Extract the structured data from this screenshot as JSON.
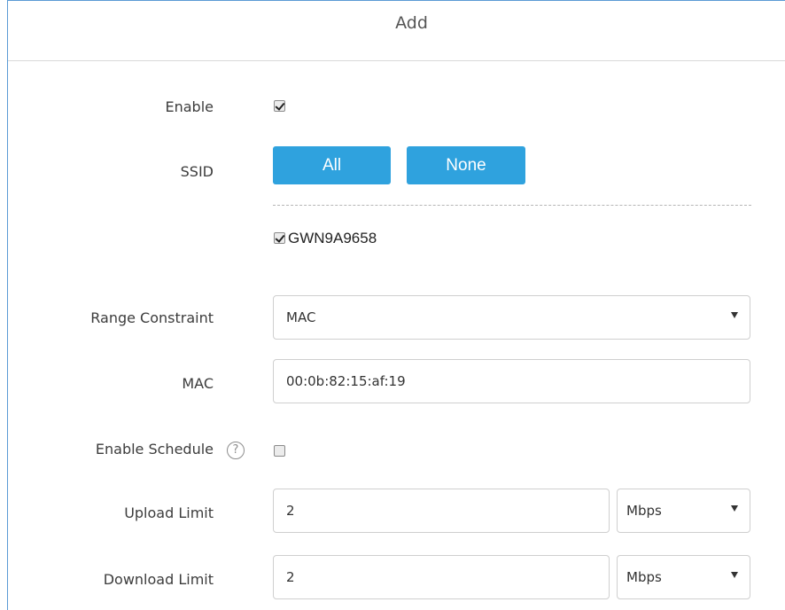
{
  "dialog": {
    "title": "Add"
  },
  "form": {
    "enable": {
      "label": "Enable",
      "checked": true
    },
    "ssid": {
      "label": "SSID",
      "all_button": "All",
      "none_button": "None",
      "items": [
        {
          "name": "GWN9A9658",
          "checked": true
        }
      ]
    },
    "range_constraint": {
      "label": "Range Constraint",
      "value": "MAC"
    },
    "mac": {
      "label": "MAC",
      "value": "00:0b:82:15:af:19"
    },
    "enable_schedule": {
      "label": "Enable Schedule",
      "help_icon": "?",
      "checked": false
    },
    "upload_limit": {
      "label": "Upload Limit",
      "value": "2",
      "unit": "Mbps"
    },
    "download_limit": {
      "label": "Download Limit",
      "value": "2",
      "unit": "Mbps"
    }
  },
  "colors": {
    "button_bg": "#2fa2de",
    "dialog_border": "#5b9bd5"
  }
}
